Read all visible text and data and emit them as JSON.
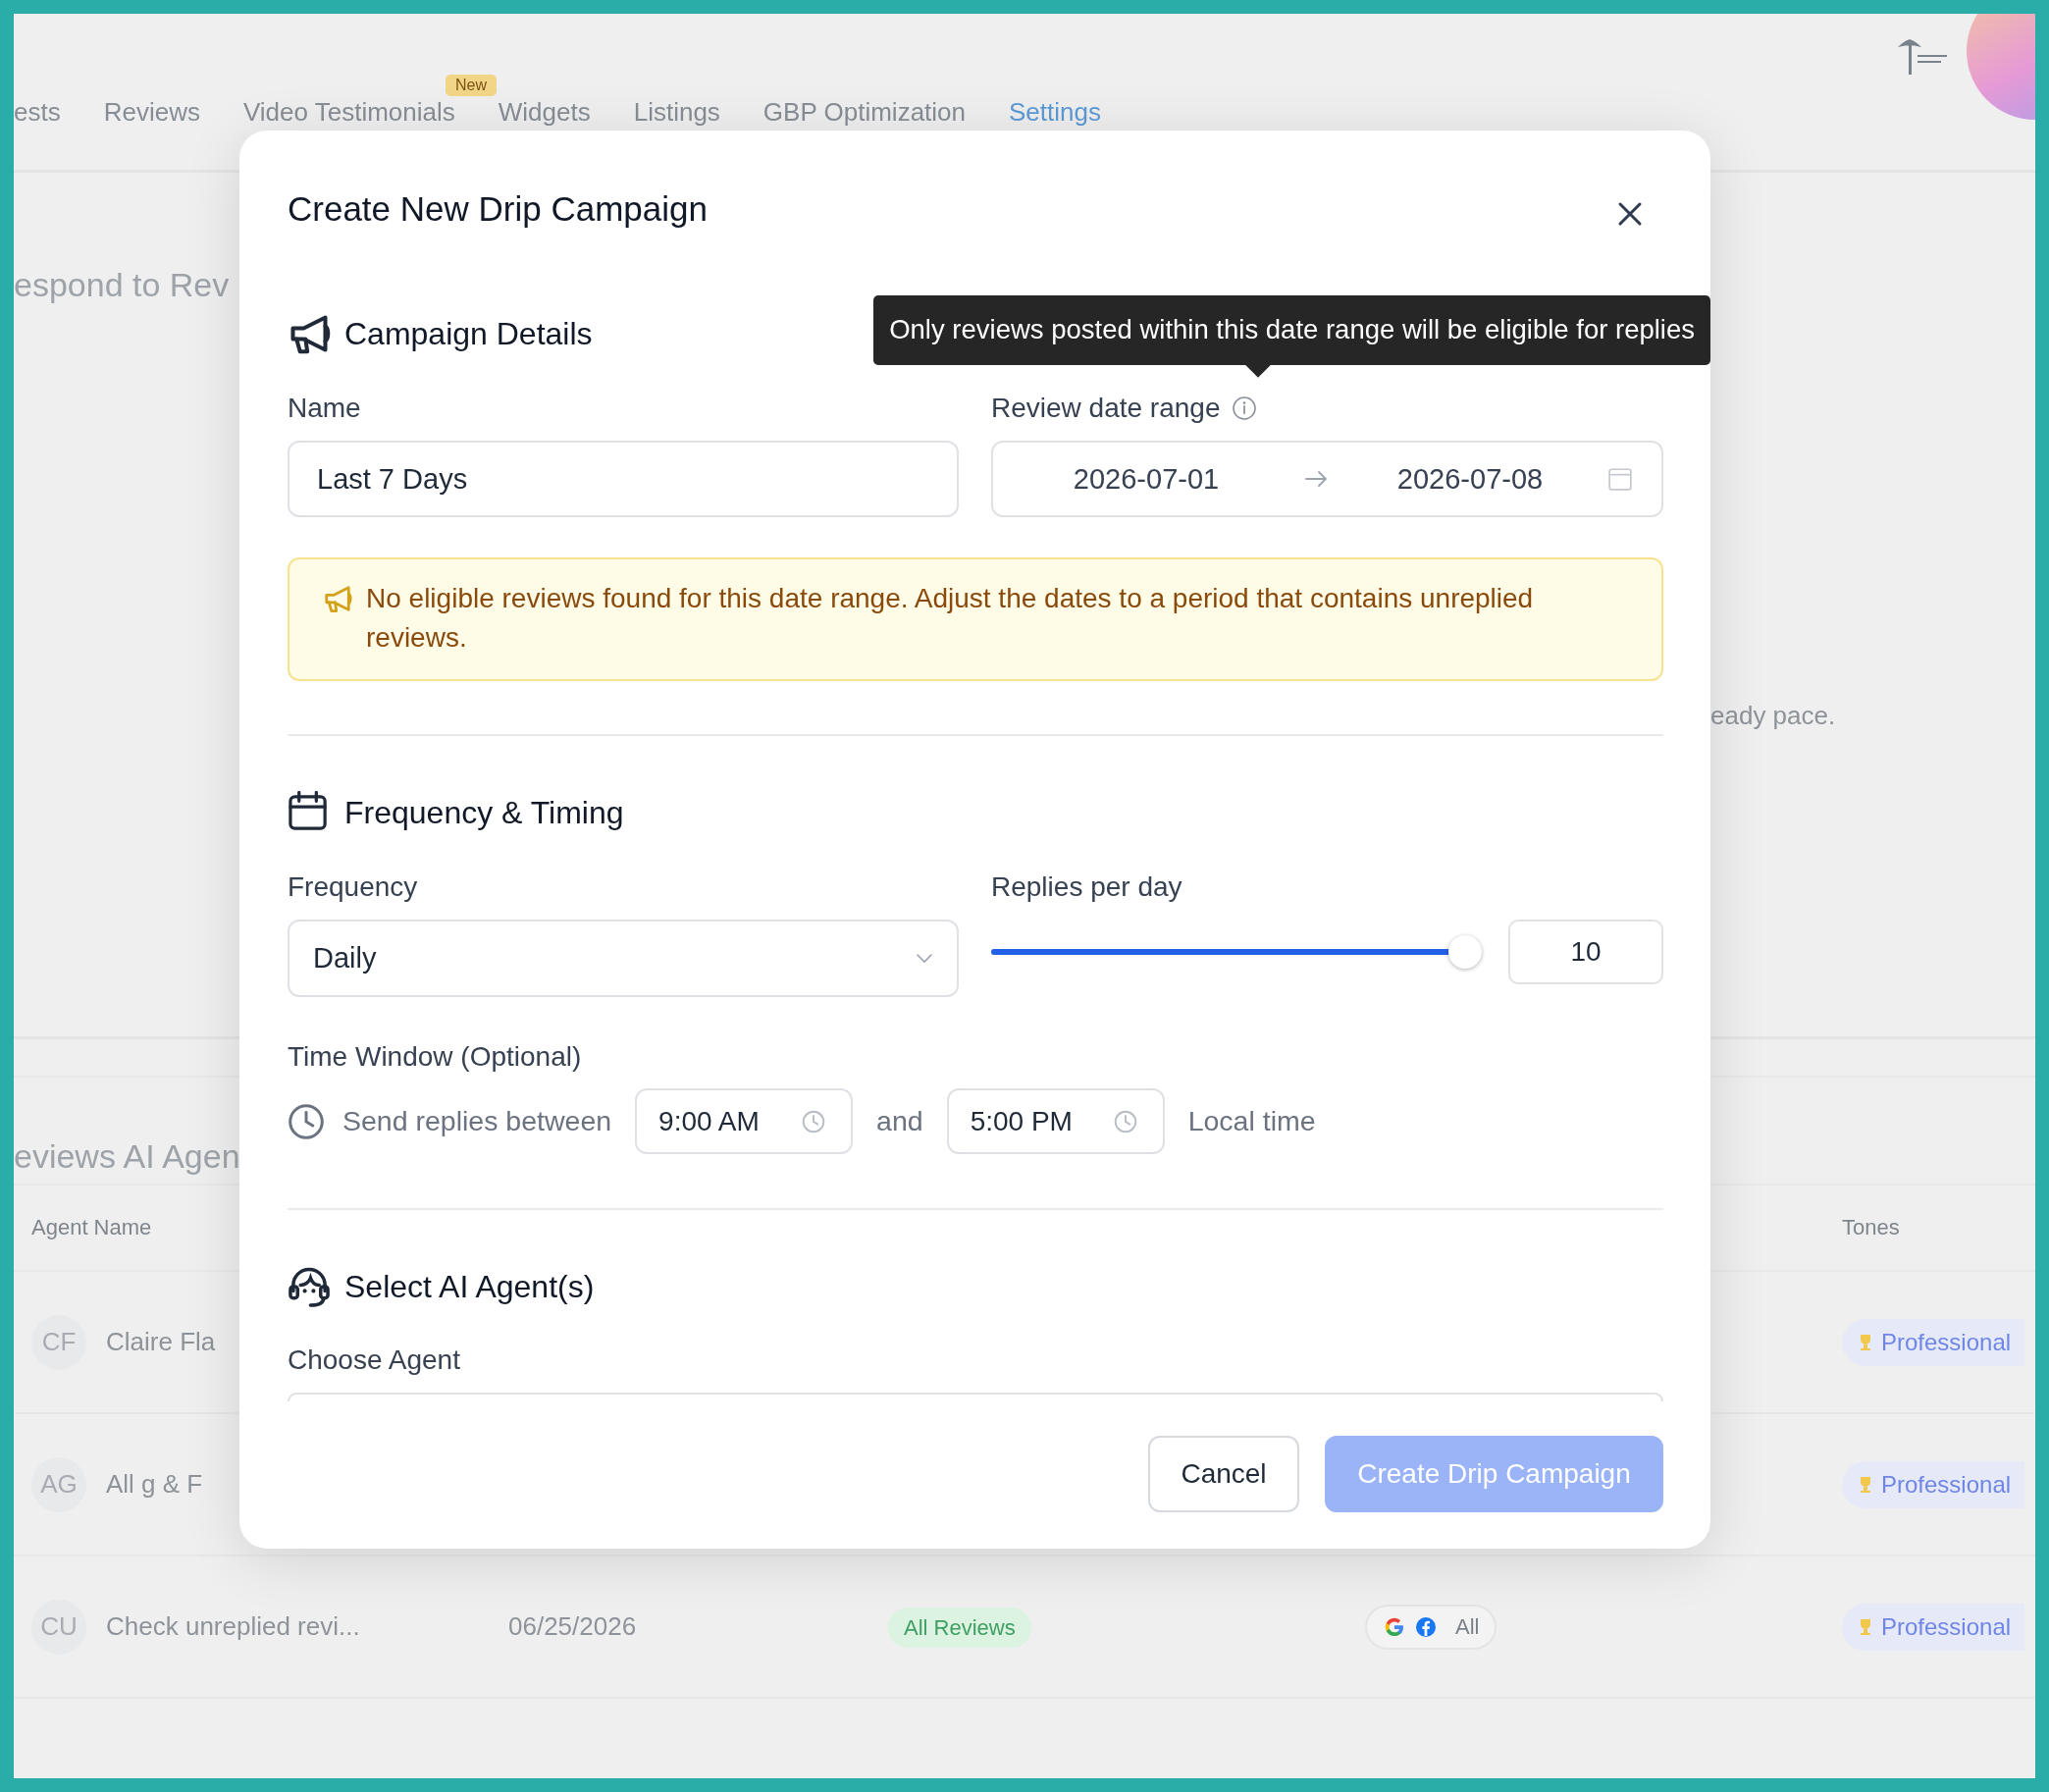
{
  "background": {
    "nav_tabs": [
      {
        "label": "ests",
        "selected": false
      },
      {
        "label": "Reviews",
        "selected": false
      },
      {
        "label": "Video Testimonials",
        "selected": false,
        "badge": "New"
      },
      {
        "label": "Widgets",
        "selected": false
      },
      {
        "label": "Listings",
        "selected": false
      },
      {
        "label": "GBP Optimization",
        "selected": false
      },
      {
        "label": "Settings",
        "selected": true
      }
    ],
    "section_heading": "espond to Rev",
    "side_text": "eady pace.",
    "agents_heading": "eviews AI Agen",
    "agents_table": {
      "columns": {
        "agent_name": "Agent Name",
        "tones": "Tones"
      },
      "rows": [
        {
          "initials": "CF",
          "name": "Claire Fla",
          "tone": "Professional"
        },
        {
          "initials": "AG",
          "name": "All g & F",
          "tone": "Professional"
        },
        {
          "initials": "CU",
          "name": "Check unreplied revi...",
          "date": "06/25/2026",
          "review_filter": "All Reviews",
          "platforms": "All",
          "tone": "Professional"
        }
      ]
    }
  },
  "modal": {
    "title": "Create New Drip Campaign",
    "tooltip": "Only reviews posted within this date range will be eligible for replies",
    "campaign_details": {
      "heading": "Campaign Details",
      "name_label": "Name",
      "name_value": "Last 7 Days",
      "date_range_label": "Review date range",
      "date_start": "2026-07-01",
      "date_end": "2026-07-08",
      "warning": "No eligible reviews found for this date range. Adjust the dates to a period that contains unreplied reviews."
    },
    "frequency_timing": {
      "heading": "Frequency & Timing",
      "frequency_label": "Frequency",
      "frequency_value": "Daily",
      "replies_label": "Replies per day",
      "replies_slider": {
        "level": 1
      },
      "replies_value": "10",
      "time_window_label": "Time Window (Optional)",
      "time_prefix": "Send replies between",
      "start_time": "9:00 AM",
      "joiner": "and",
      "end_time": "5:00 PM",
      "time_suffix": "Local time"
    },
    "agents": {
      "heading": "Select AI Agent(s)",
      "choose_label": "Choose Agent"
    },
    "buttons": [
      {
        "label": "Cancel",
        "kind": "secondary",
        "disabled": false
      },
      {
        "label": "Create Drip Campaign",
        "kind": "primary",
        "disabled": true
      }
    ]
  }
}
